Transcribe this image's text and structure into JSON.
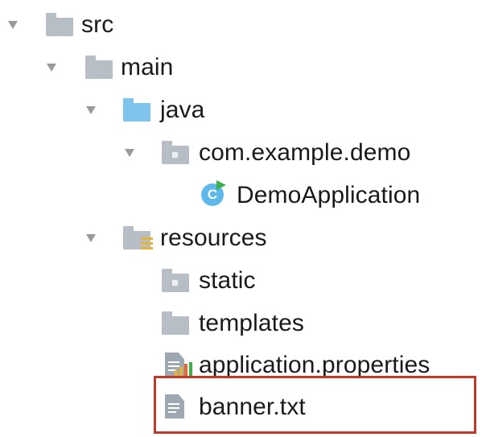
{
  "tree": {
    "src": {
      "label": "src",
      "icon": "folder-icon",
      "expanded": true
    },
    "main": {
      "label": "main",
      "icon": "folder-icon",
      "expanded": true
    },
    "java": {
      "label": "java",
      "icon": "source-folder-icon",
      "expanded": true
    },
    "package": {
      "label": "com.example.demo",
      "icon": "package-icon",
      "expanded": true
    },
    "demo_app": {
      "label": "DemoApplication",
      "icon": "spring-boot-class-icon",
      "icon_glyph": "C"
    },
    "resources": {
      "label": "resources",
      "icon": "resources-folder-icon",
      "expanded": true
    },
    "static": {
      "label": "static",
      "icon": "folder-icon"
    },
    "templates": {
      "label": "templates",
      "icon": "folder-icon"
    },
    "app_props": {
      "label": "application.properties",
      "icon": "properties-file-icon"
    },
    "banner": {
      "label": "banner.txt",
      "icon": "text-file-icon",
      "highlighted": true
    }
  },
  "colors": {
    "folder_gray": "#b7bec6",
    "folder_blue": "#7fc4ec",
    "class_icon": "#5fb8ea",
    "run_marker": "#3db04a",
    "resource_bars": "#e3b33a",
    "highlight_border": "#c0392b"
  }
}
